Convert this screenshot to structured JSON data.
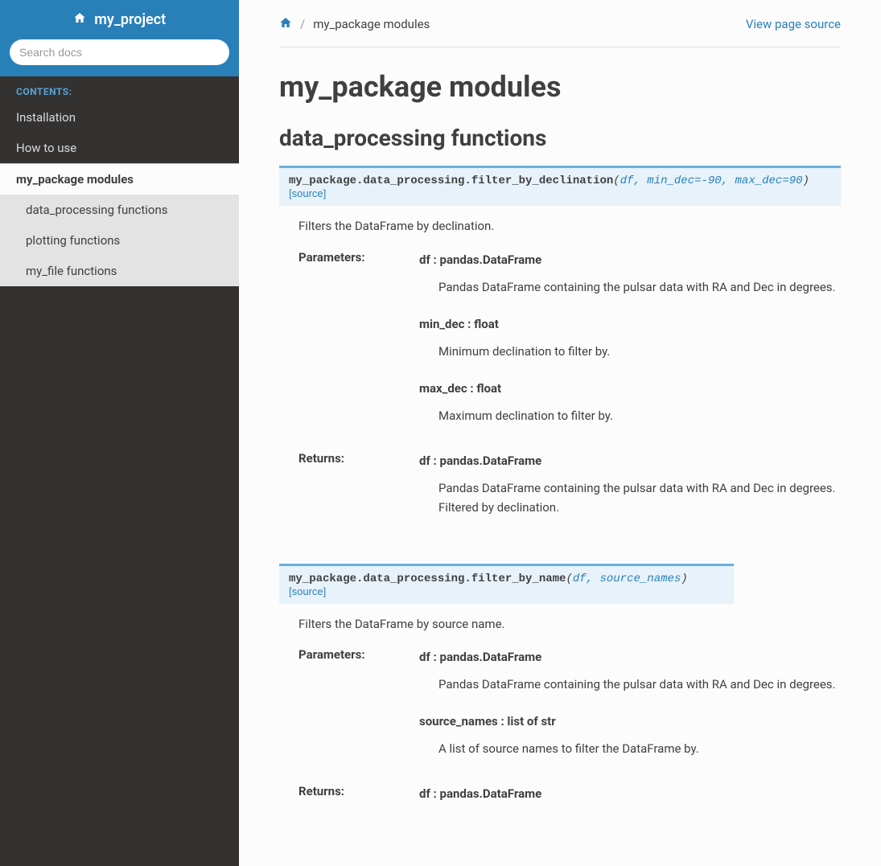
{
  "project_name": "my_project",
  "search": {
    "placeholder": "Search docs"
  },
  "nav": {
    "caption": "CONTENTS:",
    "items": [
      {
        "label": "Installation"
      },
      {
        "label": "How to use"
      },
      {
        "label": "my_package modules"
      }
    ],
    "subs": [
      {
        "label": "data_processing functions"
      },
      {
        "label": "plotting functions"
      },
      {
        "label": "my_file functions"
      }
    ]
  },
  "breadcrumb": {
    "current": "my_package modules",
    "view_source": "View page source"
  },
  "page": {
    "h1": "my_package modules",
    "h2": "data_processing functions"
  },
  "functions": [
    {
      "module": "my_package.data_processing.",
      "name": "filter_by_declination",
      "params_str": "df, min_dec=-90, max_dec=90",
      "source_label": "[source]",
      "desc": "Filters the DataFrame by declination.",
      "parameters_label": "Parameters:",
      "parameters": [
        {
          "name": "df",
          "type": " : pandas.DataFrame",
          "desc": "Pandas DataFrame containing the pulsar data with RA and Dec in degrees."
        },
        {
          "name": "min_dec",
          "type": " : float",
          "desc": "Minimum declination to filter by."
        },
        {
          "name": "max_dec",
          "type": " : float",
          "desc": "Maximum declination to filter by."
        }
      ],
      "returns_label": "Returns:",
      "returns": [
        {
          "name": "df",
          "type": " : pandas.DataFrame",
          "desc": "Pandas DataFrame containing the pulsar data with RA and Dec in degrees. Filtered by declination."
        }
      ]
    },
    {
      "module": "my_package.data_processing.",
      "name": "filter_by_name",
      "params_str": "df, source_names",
      "source_label": "[source]",
      "desc": "Filters the DataFrame by source name.",
      "parameters_label": "Parameters:",
      "parameters": [
        {
          "name": "df",
          "type": " : pandas.DataFrame",
          "desc": "Pandas DataFrame containing the pulsar data with RA and Dec in degrees."
        },
        {
          "name": "source_names",
          "type": " : list of str",
          "desc": "A list of source names to filter the DataFrame by."
        }
      ],
      "returns_label": "Returns:",
      "returns": [
        {
          "name": "df",
          "type": " : pandas.DataFrame",
          "desc": ""
        }
      ]
    }
  ]
}
